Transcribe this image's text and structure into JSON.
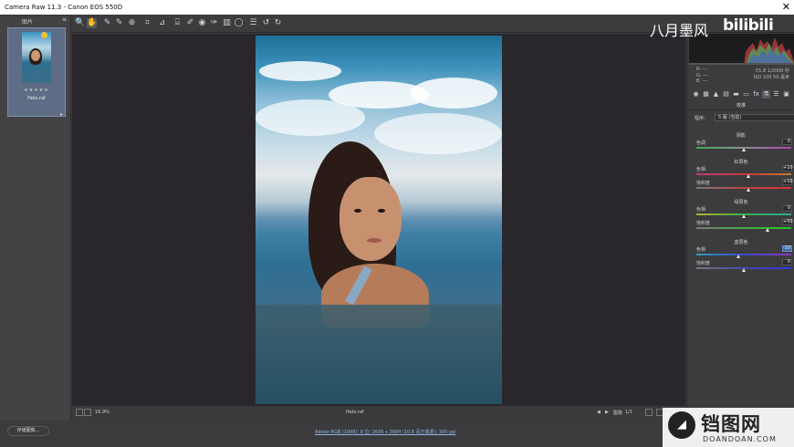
{
  "window": {
    "title": "Camera Raw 11.3  -   Canon EOS 550D",
    "close_glyph": "✕"
  },
  "toolbar": {
    "tools": [
      {
        "name": "zoom-tool-icon",
        "glyph": "🔍"
      },
      {
        "name": "hand-tool-icon",
        "glyph": "✋"
      },
      {
        "name": "white-balance-tool-icon",
        "glyph": "✎"
      },
      {
        "name": "color-sampler-tool-icon",
        "glyph": "✎"
      },
      {
        "name": "targeted-adjustment-tool-icon",
        "glyph": "⊕"
      },
      {
        "name": "crop-tool-icon",
        "glyph": "⌗"
      },
      {
        "name": "straighten-tool-icon",
        "glyph": "⊿"
      },
      {
        "name": "transform-tool-icon",
        "glyph": "⌸"
      },
      {
        "name": "spot-removal-tool-icon",
        "glyph": "✐"
      },
      {
        "name": "red-eye-tool-icon",
        "glyph": "◉"
      },
      {
        "name": "adjustment-brush-icon",
        "glyph": "✑"
      },
      {
        "name": "graduated-filter-icon",
        "glyph": "▥"
      },
      {
        "name": "radial-filter-icon",
        "glyph": "◯"
      },
      {
        "name": "preferences-icon",
        "glyph": "☰"
      },
      {
        "name": "rotate-left-icon",
        "glyph": "↺"
      },
      {
        "name": "rotate-right-icon",
        "glyph": "↻"
      }
    ]
  },
  "filmstrip": {
    "header": "图片",
    "menu_glyph": "≡",
    "stars": "★★★★★",
    "filename": "Helo.raf",
    "expand_glyph": "▸"
  },
  "preview": {
    "zoom": "16.9%",
    "filename": "Helo.raf",
    "image_count": "1/1",
    "nav_label": "图像"
  },
  "histogram": {
    "readout_labels": [
      "R:",
      "G:",
      "B:"
    ],
    "readout_values": [
      "---",
      "---",
      "---"
    ],
    "camera_info": [
      "f/1.8   1/2000 秒",
      "ISO 100   50 毫米"
    ]
  },
  "panel": {
    "title": "校准",
    "program_label": "程序:",
    "program_value": "5 版 (当前)",
    "sections": [
      {
        "title": "阴影",
        "sliders": [
          {
            "label": "色调",
            "value": "0",
            "knob": 0.5,
            "gradient": "linear-gradient(90deg,#3fae5a,#8e8e8e,#b048b0)",
            "highlight": false
          }
        ]
      },
      {
        "title": "红原色",
        "sliders": [
          {
            "label": "色相",
            "value": "+10",
            "knob": 0.55,
            "gradient": "linear-gradient(90deg,#c03d7a,#c73838,#c87a30)",
            "highlight": false
          },
          {
            "label": "饱和度",
            "value": "+10",
            "knob": 0.55,
            "gradient": "linear-gradient(90deg,#7a7a7a,#b44,#d33)",
            "highlight": false
          }
        ]
      },
      {
        "title": "绿原色",
        "sliders": [
          {
            "label": "色相",
            "value": "0",
            "knob": 0.5,
            "gradient": "linear-gradient(90deg,#b5b032,#3fae4a,#2eaa9a)",
            "highlight": false
          },
          {
            "label": "饱和度",
            "value": "+50",
            "knob": 0.75,
            "gradient": "linear-gradient(90deg,#7a7a7a,#4a4,#2c2)",
            "highlight": false
          }
        ]
      },
      {
        "title": "蓝原色",
        "sliders": [
          {
            "label": "色相",
            "value": "-10",
            "knob": 0.45,
            "gradient": "linear-gradient(90deg,#2fa0b0,#3748c8,#8a3cc4)",
            "highlight": true
          },
          {
            "label": "饱和度",
            "value": "0",
            "knob": 0.5,
            "gradient": "linear-gradient(90deg,#7a7a7a,#44a,#33d)",
            "highlight": false
          }
        ]
      }
    ]
  },
  "footer": {
    "save_button": "存储图像...",
    "workflow_link": "Adobe RGB (1998); 8 位; 2656 x 3984 (10.6 百万像素); 300 ppi"
  },
  "watermarks": {
    "top_text": "八月墨风",
    "bili_text": "bilibili",
    "corner_title": "铛图网",
    "corner_sub": "DOANDOAN.COM",
    "corner_icon": "◢"
  },
  "colors": {
    "panel_bg": "#3c3c3f",
    "canvas_bg": "#29272b",
    "accent_blue": "#3f6ea8"
  }
}
